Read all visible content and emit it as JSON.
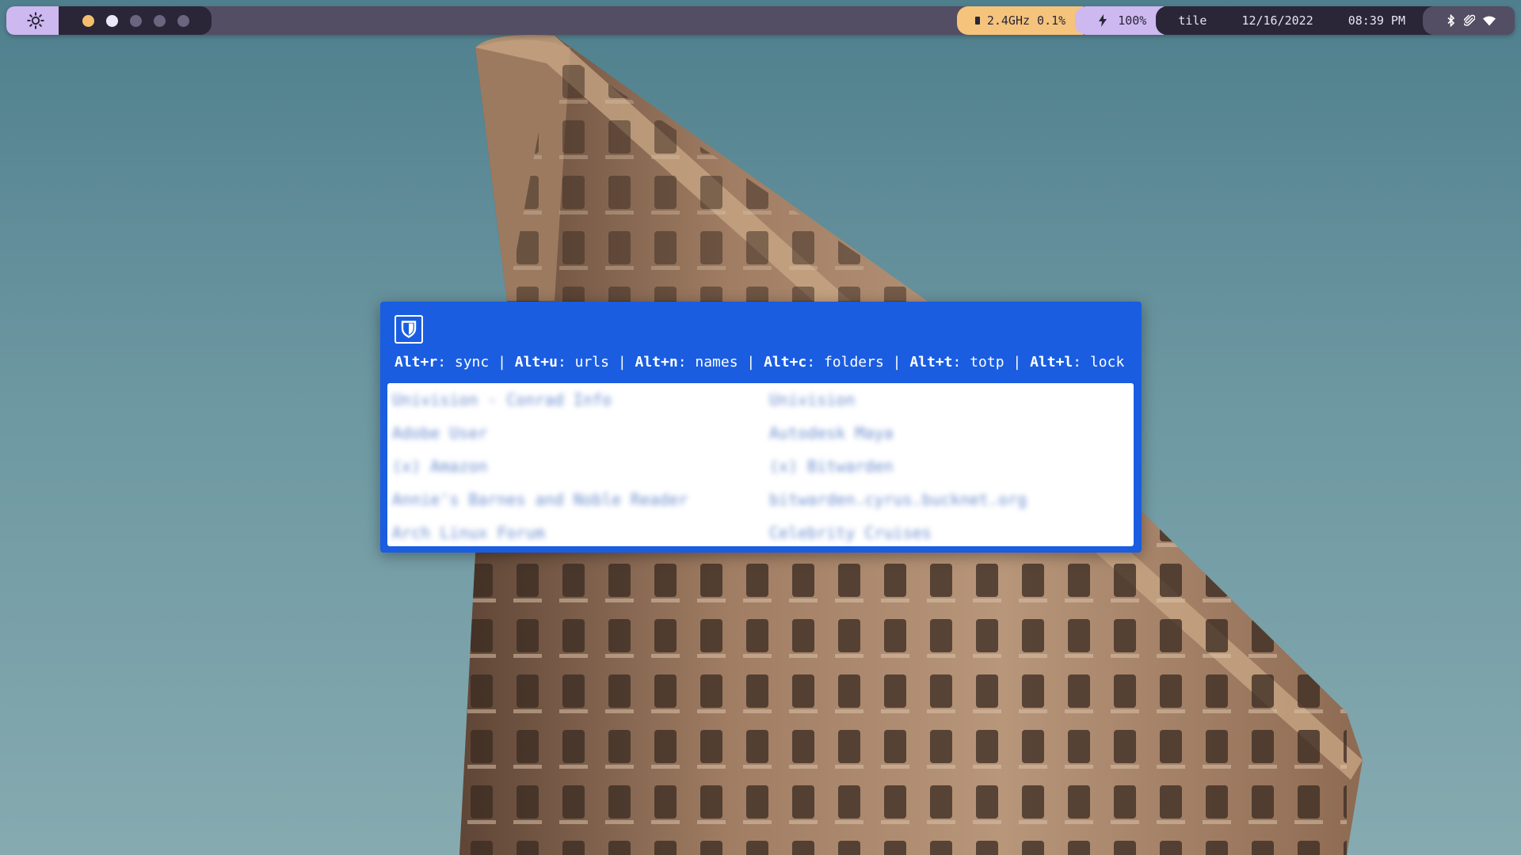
{
  "bar": {
    "launcher_icon": "gear-icon",
    "workspaces": [
      {
        "state": "active",
        "color": "#f5be6e"
      },
      {
        "state": "occupied",
        "color": "#ece7f9"
      },
      {
        "state": "empty",
        "color": "#6c6580"
      },
      {
        "state": "empty",
        "color": "#6c6580"
      },
      {
        "state": "empty",
        "color": "#6c6580"
      }
    ],
    "cpu": {
      "icon": "cpu-icon",
      "text": "2.4GHz 0.1%"
    },
    "battery": {
      "icon": "lightning-icon",
      "text": "100%"
    },
    "layout": "tile",
    "date": "12/16/2022",
    "time": "08:39 PM",
    "tray": [
      "bluetooth-icon",
      "paperclip-icon",
      "wifi-icon"
    ]
  },
  "bitwarden": {
    "logo_icon": "bitwarden-shield-icon",
    "help": [
      {
        "key": "Alt+r",
        "action": "sync"
      },
      {
        "key": "Alt+u",
        "action": "urls"
      },
      {
        "key": "Alt+n",
        "action": "names"
      },
      {
        "key": "Alt+c",
        "action": "folders"
      },
      {
        "key": "Alt+t",
        "action": "totp"
      },
      {
        "key": "Alt+l",
        "action": "lock"
      }
    ],
    "entries": [
      "Univision - Conrad Info",
      "Univision",
      "Adobe User",
      "Autodesk Maya",
      "(x) Amazon",
      "(x) Bitwarden",
      "Annie's Barnes and Noble Reader",
      "bitwarden.cyrus.bucknet.org",
      "Arch Linux Forum",
      "Celebrity Cruises"
    ]
  },
  "colors": {
    "bitwarden_blue": "#1a5de1",
    "bar_dark": "#2a2638",
    "bar_purple": "#cdb8f0",
    "bar_orange": "#f5c37c"
  }
}
